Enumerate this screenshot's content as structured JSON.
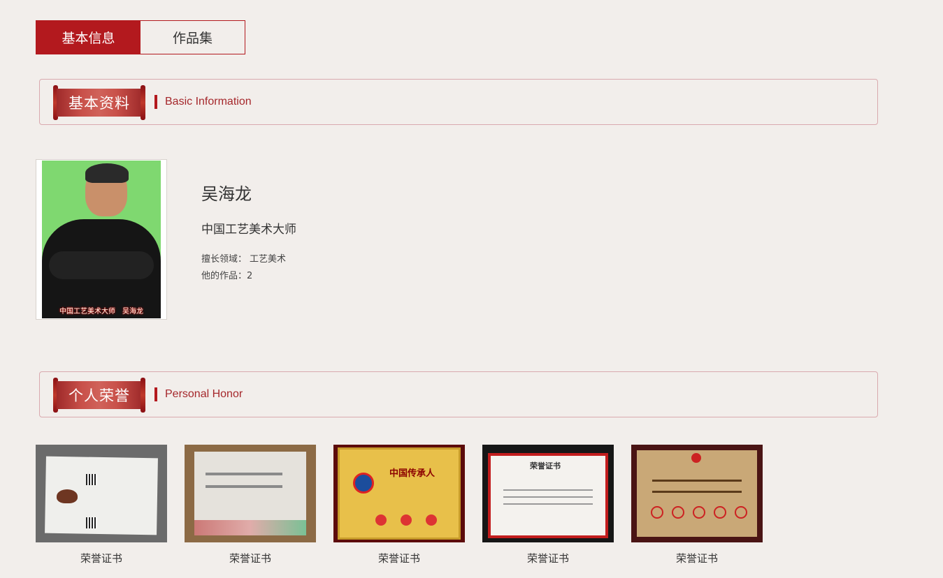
{
  "tabs": [
    {
      "label": "基本信息",
      "active": true
    },
    {
      "label": "作品集",
      "active": false
    }
  ],
  "sections": {
    "basic": {
      "title_cn": "基本资料",
      "title_en": "Basic Information"
    },
    "honor": {
      "title_cn": "个人荣誉",
      "title_en": "Personal Honor"
    }
  },
  "profile": {
    "portrait_caption": "中国工艺美术大师　吴海龙",
    "name": "吴海龙",
    "title": "中国工艺美术大师",
    "specialty_label": "擅长领域：",
    "specialty_value": "工艺美术",
    "works_label": "他的作品：",
    "works_count": "2"
  },
  "honors": [
    {
      "caption": "荣誉证书"
    },
    {
      "caption": "荣誉证书"
    },
    {
      "caption": "荣誉证书",
      "heading": "中国传承人"
    },
    {
      "caption": "荣誉证书",
      "heading": "荣誉证书"
    },
    {
      "caption": "荣誉证书"
    }
  ],
  "colors": {
    "accent": "#b3191e",
    "background": "#f2eeeb",
    "section_border": "#d9a9ae",
    "en_title": "#a5272b"
  }
}
